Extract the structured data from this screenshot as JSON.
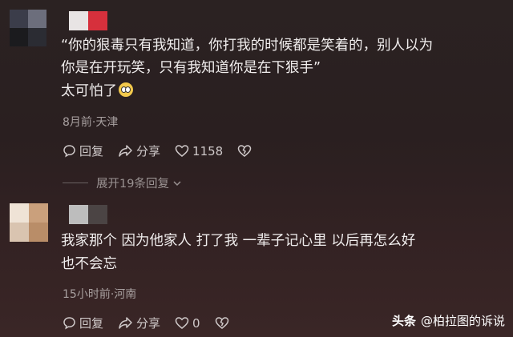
{
  "comments": [
    {
      "lines": [
        "“你的狠毒只有我知道，你打我的时候都是笑着的，别人以为",
        "你是在开玩笑，只有我知道你是在下狠手”",
        "太可怕了"
      ],
      "meta": "8月前·天津",
      "reply_label": "回复",
      "share_label": "分享",
      "like_count": "1158",
      "replies_label": "展开19条回复",
      "avatar_colors": [
        "#3b3d4a",
        "#6c6e7c",
        "#1b1b1e",
        "#2b2c33"
      ],
      "name_colors": [
        "#e8e4e4",
        "#d6303c"
      ]
    },
    {
      "lines": [
        "我家那个  因为他家人    打了我    一辈子记心里    以后再怎么好",
        "也不会忘"
      ],
      "meta": "15小时前·河南",
      "reply_label": "回复",
      "share_label": "分享",
      "like_count": "0",
      "avatar_colors": [
        "#efe3d6",
        "#caa07c",
        "#d9c4b0",
        "#b98d68"
      ],
      "name_colors": [
        "#bdbdbd",
        "#4b4444"
      ]
    }
  ],
  "watermark": {
    "brand": "头条",
    "account": "@柏拉图的诉说"
  }
}
